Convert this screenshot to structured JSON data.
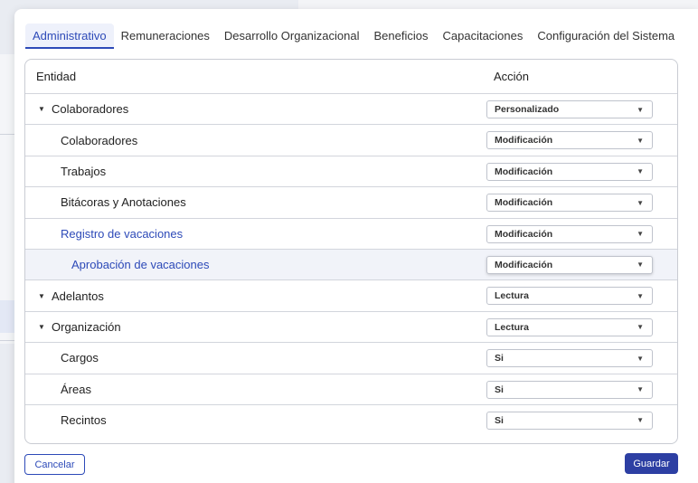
{
  "tabs": [
    {
      "label": "Administrativo",
      "active": true
    },
    {
      "label": "Remuneraciones",
      "active": false
    },
    {
      "label": "Desarrollo Organizacional",
      "active": false
    },
    {
      "label": "Beneficios",
      "active": false
    },
    {
      "label": "Capacitaciones",
      "active": false
    },
    {
      "label": "Configuración del Sistema",
      "active": false
    }
  ],
  "table": {
    "headers": {
      "entity": "Entidad",
      "action": "Acción"
    },
    "rows": [
      {
        "name": "Colaboradores",
        "action": "Personalizado",
        "level": 0,
        "expandable": true
      },
      {
        "name": "Colaboradores",
        "action": "Modificación",
        "level": 1
      },
      {
        "name": "Trabajos",
        "action": "Modificación",
        "level": 1
      },
      {
        "name": "Bitácoras y Anotaciones",
        "action": "Modificación",
        "level": 1
      },
      {
        "name": "Registro de vacaciones",
        "action": "Modificación",
        "level": 1,
        "highlighted": true
      },
      {
        "name": "Aprobación de vacaciones",
        "action": "Modificación",
        "level": 2,
        "highlighted": true,
        "selected": true
      },
      {
        "name": "Adelantos",
        "action": "Lectura",
        "level": 0,
        "expandable": true
      },
      {
        "name": "Organización",
        "action": "Lectura",
        "level": 0,
        "expandable": true
      },
      {
        "name": "Cargos",
        "action": "Si",
        "level": 1
      },
      {
        "name": "Áreas",
        "action": "Si",
        "level": 1
      },
      {
        "name": "Recintos",
        "action": "Si",
        "level": 1
      }
    ]
  },
  "buttons": {
    "cancel": "Cancelar",
    "save": "Guardar"
  },
  "colors": {
    "accent": "#2d4ab8",
    "save_bg": "#2d3fa3",
    "row_selected": "#f1f3f9"
  }
}
